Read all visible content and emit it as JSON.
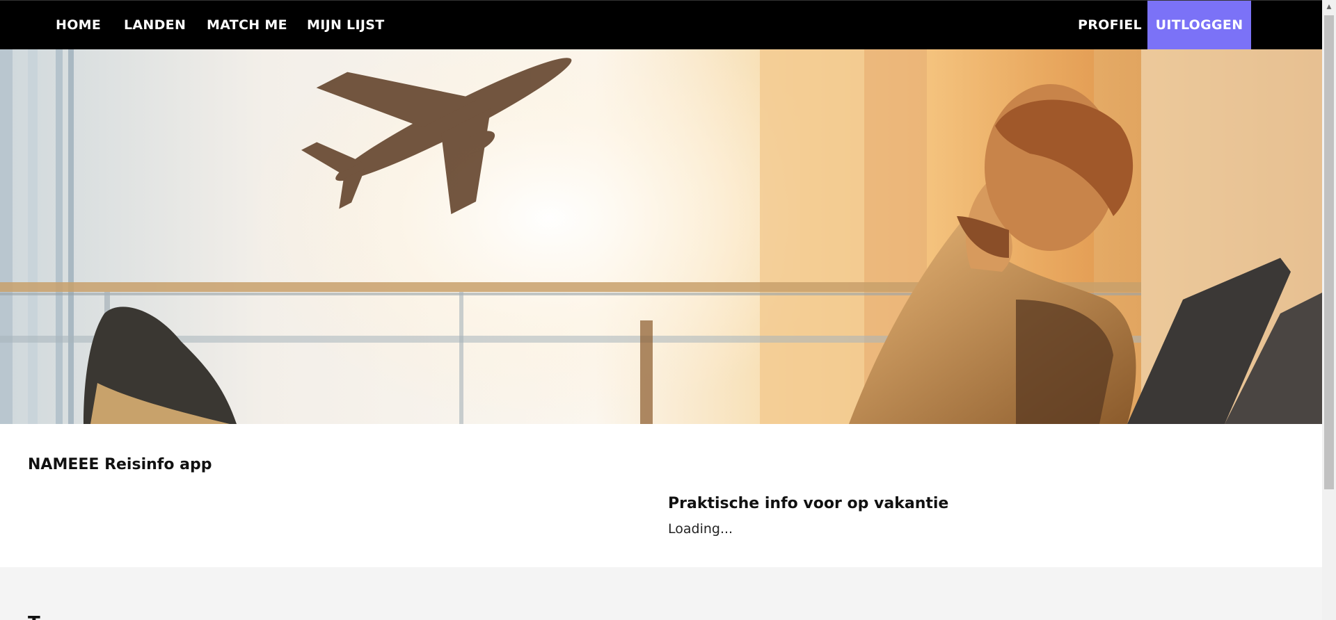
{
  "nav": {
    "home": "HOME",
    "landen": "LANDEN",
    "match_me": "MATCH ME",
    "mijn_lijst": "MIJN LIJST",
    "profiel": "PROFIEL",
    "uitloggen": "UITLOGGEN"
  },
  "colors": {
    "navbar_bg": "#000000",
    "logout_accent": "#7b72f7",
    "grey_section": "#f4f4f4"
  },
  "hero": {
    "image": "airport-traveler-airplane-photo"
  },
  "main": {
    "app_title": "NAMEEE Reisinfo app",
    "info_heading": "Praktische info voor op vakantie",
    "info_status": "Loading..."
  },
  "section2": {
    "heading_partial": "T"
  }
}
